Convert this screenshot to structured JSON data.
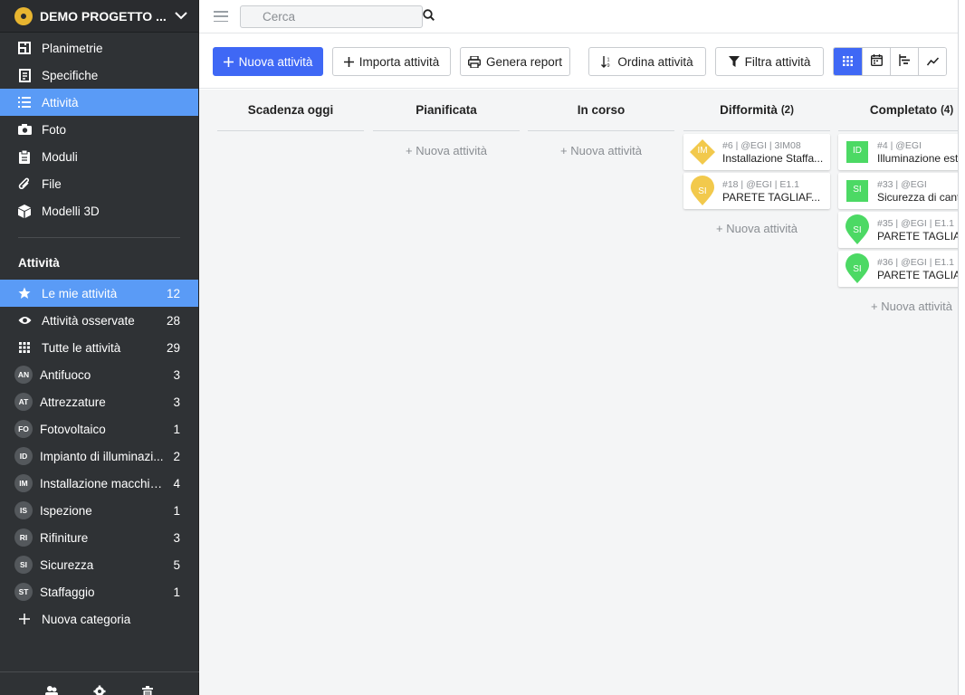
{
  "project": {
    "name": "DEMO PROGETTO ..."
  },
  "nav": [
    {
      "label": "Planimetrie",
      "icon": "floorplan-icon"
    },
    {
      "label": "Specifiche",
      "icon": "document-icon"
    },
    {
      "label": "Attività",
      "icon": "list-icon",
      "active": true
    },
    {
      "label": "Foto",
      "icon": "camera-icon"
    },
    {
      "label": "Moduli",
      "icon": "clipboard-icon"
    },
    {
      "label": "File",
      "icon": "paperclip-icon"
    },
    {
      "label": "Modelli 3D",
      "icon": "cube-icon"
    }
  ],
  "activities_section": {
    "title": "Attività",
    "items": [
      {
        "label": "Le mie attività",
        "count": "12",
        "icon": "star-icon",
        "active": true
      },
      {
        "label": "Attività osservate",
        "count": "28",
        "icon": "eye-icon"
      },
      {
        "label": "Tutte le attività",
        "count": "29",
        "icon": "grid-icon"
      },
      {
        "label": "Antifuoco",
        "count": "3",
        "badge": "AN"
      },
      {
        "label": "Attrezzature",
        "count": "3",
        "badge": "AT"
      },
      {
        "label": "Fotovoltaico",
        "count": "1",
        "badge": "FO"
      },
      {
        "label": "Impianto di illuminazi...",
        "count": "2",
        "badge": "ID"
      },
      {
        "label": "Installazione macchin...",
        "count": "4",
        "badge": "IM"
      },
      {
        "label": "Ispezione",
        "count": "1",
        "badge": "IS"
      },
      {
        "label": "Rifiniture",
        "count": "3",
        "badge": "RI"
      },
      {
        "label": "Sicurezza",
        "count": "5",
        "badge": "SI"
      },
      {
        "label": "Staffaggio",
        "count": "1",
        "badge": "ST"
      }
    ],
    "new_category": "Nuova categoria"
  },
  "search": {
    "placeholder": "Cerca"
  },
  "toolbar": {
    "new_task": "Nuova attività",
    "import_tasks": "Importa attività",
    "report": "Genera report",
    "sort": "Ordina attività",
    "filter": "Filtra attività"
  },
  "board": {
    "add_label": "+ Nuova attività",
    "columns": [
      {
        "title": "Scadenza oggi",
        "count": "",
        "cards": [],
        "show_add": false
      },
      {
        "title": "Pianificata",
        "count": "",
        "cards": [],
        "show_add": true
      },
      {
        "title": "In corso",
        "count": "",
        "cards": [],
        "show_add": true
      },
      {
        "title": "Difformità",
        "count": "(2)",
        "show_add": true,
        "cards": [
          {
            "meta": "#6 | @EGI | 3IM08",
            "title": "Installazione Staffa...",
            "badge": "IM",
            "shape": "diamond",
            "color": "#f2c94c"
          },
          {
            "meta": "#18 | @EGI | E1.1",
            "title": "PARETE TAGLIAF...",
            "badge": "SI",
            "shape": "pin",
            "color": "#f2c94c"
          }
        ]
      },
      {
        "title": "Completato",
        "count": "(4)",
        "show_add": true,
        "cards": [
          {
            "meta": "#4 | @EGI",
            "title": "Illuminazione est",
            "badge": "ID",
            "shape": "square",
            "color": "#4cd964"
          },
          {
            "meta": "#33 | @EGI",
            "title": "Sicurezza di canti",
            "badge": "SI",
            "shape": "square",
            "color": "#4cd964"
          },
          {
            "meta": "#35 | @EGI | E1.1",
            "title": "PARETE TAGLIAI",
            "badge": "SI",
            "shape": "pin",
            "color": "#4cd964"
          },
          {
            "meta": "#36 | @EGI | E1.1",
            "title": "PARETE TAGLIAI",
            "badge": "SI",
            "shape": "pin",
            "color": "#4cd964"
          }
        ]
      }
    ]
  },
  "colors": {
    "accent": "#3f68f5",
    "active_nav": "#5a9bf6",
    "sidebar_bg": "#2f3235"
  }
}
